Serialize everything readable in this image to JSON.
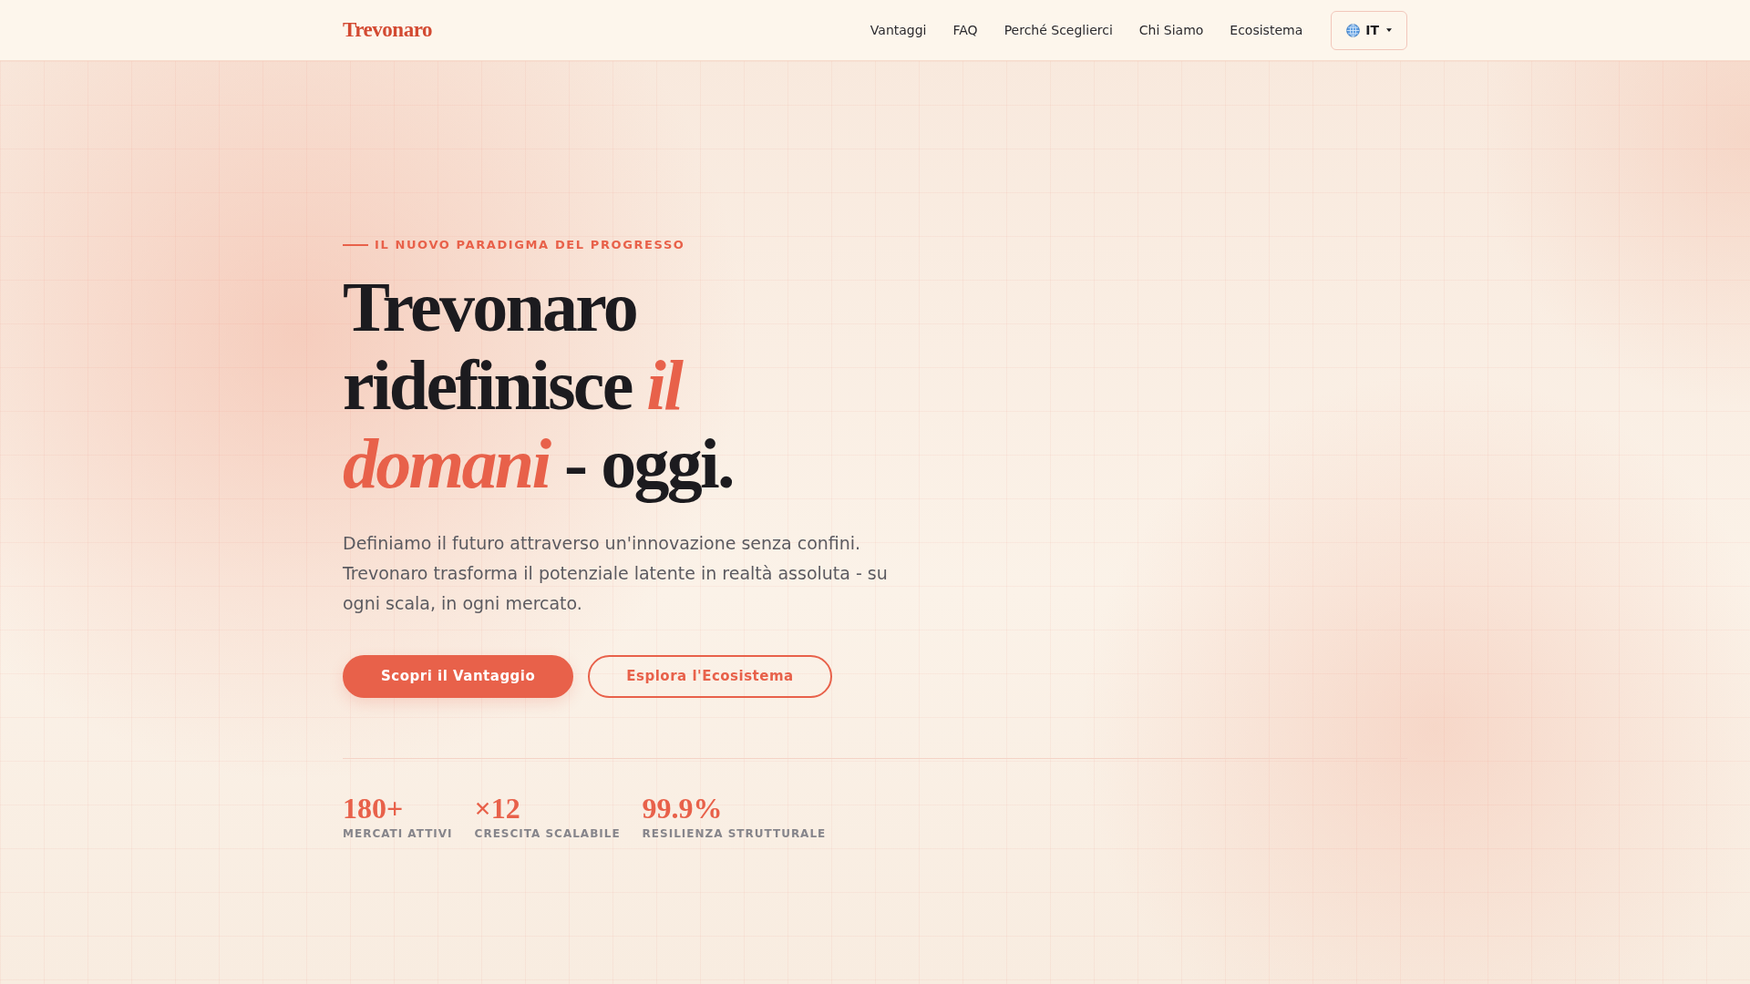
{
  "nav": {
    "logo": "Trevonaro",
    "links": [
      "Vantaggi",
      "FAQ",
      "Perché Sceglierci",
      "Chi Siamo",
      "Ecosistema"
    ],
    "language": {
      "code": "IT"
    }
  },
  "hero": {
    "eyebrow": "IL NUOVO PARADIGMA DEL PROGRESSO",
    "title": "Trevonaro ridefinisce *il domani* - oggi.",
    "description": "Definiamo il futuro attraverso un'innovazione senza confini. Trevonaro trasforma il potenziale latente in realtà assoluta - su ogni scala, in ogni mercato.",
    "buttons": [
      {
        "label": "Scopri il Vantaggio",
        "kind": "primary"
      },
      {
        "label": "Esplora l'Ecosistema",
        "kind": "secondary"
      }
    ]
  },
  "stats": [
    {
      "value": "180+",
      "label": "MERCATI ATTIVI"
    },
    {
      "value": "×12",
      "label": "CRESCITA SCALABILE"
    },
    {
      "value": "99.9%",
      "label": "RESILIENZA STRUTTURALE"
    }
  ]
}
